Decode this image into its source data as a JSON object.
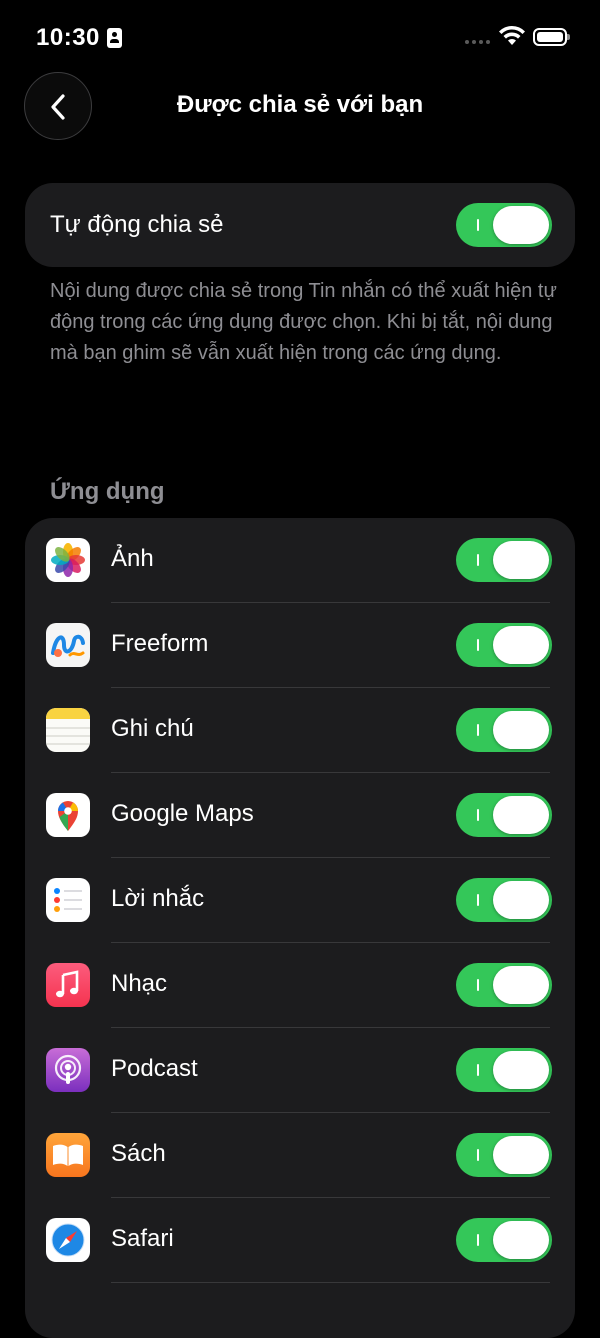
{
  "status_bar": {
    "time": "10:30"
  },
  "header": {
    "title": "Được chia sẻ với bạn"
  },
  "auto_share": {
    "label": "Tự động chia sẻ",
    "enabled": true
  },
  "footnote": "Nội dung được chia sẻ trong Tin nhắn có thể xuất hiện tự động trong các ứng dụng được chọn. Khi bị tắt, nội dung mà bạn ghim sẽ vẫn xuất hiện trong các ứng dụng.",
  "apps_section": {
    "header": "Ứng dụng",
    "items": [
      {
        "label": "Ảnh",
        "icon": "photos-icon",
        "enabled": true
      },
      {
        "label": "Freeform",
        "icon": "freeform-icon",
        "enabled": true
      },
      {
        "label": "Ghi chú",
        "icon": "notes-icon",
        "enabled": true
      },
      {
        "label": "Google Maps",
        "icon": "google-maps-icon",
        "enabled": true
      },
      {
        "label": "Lời nhắc",
        "icon": "reminders-icon",
        "enabled": true
      },
      {
        "label": "Nhạc",
        "icon": "music-icon",
        "enabled": true
      },
      {
        "label": "Podcast",
        "icon": "podcasts-icon",
        "enabled": true
      },
      {
        "label": "Sách",
        "icon": "books-icon",
        "enabled": true
      },
      {
        "label": "Safari",
        "icon": "safari-icon",
        "enabled": true
      }
    ]
  },
  "colors": {
    "accent_toggle": "#34c759",
    "card": "#1c1c1e",
    "secondary_text": "#8e8e93"
  }
}
